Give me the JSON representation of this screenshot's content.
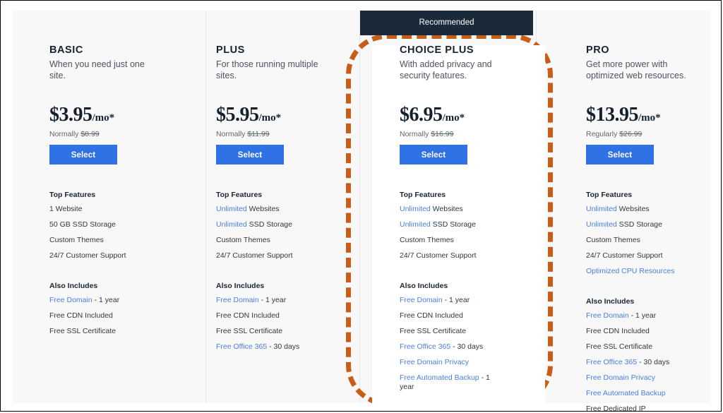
{
  "colors": {
    "accent_blue": "#2f72e5",
    "link_blue": "#4a7fe0",
    "badge_navy": "#1b2a3b",
    "annotation_orange": "#c75d17",
    "card_background": "#f8f8f9"
  },
  "badge": {
    "label": "Recommended"
  },
  "plans": [
    {
      "name": "BASIC",
      "tagline": "When you need just one site.",
      "price": "$3.95",
      "price_period": "/mo*",
      "normally_label": "Normally",
      "normally_price": "$8.99",
      "select_label": "Select",
      "top_features_heading": "Top Features",
      "top_features": [
        {
          "link": "",
          "text": "1 Website"
        },
        {
          "link": "",
          "text": "50 GB SSD Storage"
        },
        {
          "link": "",
          "text": "Custom Themes"
        },
        {
          "link": "",
          "text": "24/7 Customer Support"
        }
      ],
      "also_includes_heading": "Also Includes",
      "also_includes": [
        {
          "link": "Free Domain",
          "text": " - 1 year"
        },
        {
          "link": "",
          "text": "Free CDN Included"
        },
        {
          "link": "",
          "text": "Free SSL Certificate"
        }
      ]
    },
    {
      "name": "PLUS",
      "tagline": "For those running multiple sites.",
      "price": "$5.95",
      "price_period": "/mo*",
      "normally_label": "Normally",
      "normally_price": "$11.99",
      "select_label": "Select",
      "top_features_heading": "Top Features",
      "top_features": [
        {
          "link": "Unlimited",
          "text": " Websites"
        },
        {
          "link": "Unlimited",
          "text": " SSD Storage"
        },
        {
          "link": "",
          "text": "Custom Themes"
        },
        {
          "link": "",
          "text": "24/7 Customer Support"
        }
      ],
      "also_includes_heading": "Also Includes",
      "also_includes": [
        {
          "link": "Free Domain",
          "text": " - 1 year"
        },
        {
          "link": "",
          "text": "Free CDN Included"
        },
        {
          "link": "",
          "text": "Free SSL Certificate"
        },
        {
          "link": "Free Office 365",
          "text": " - 30 days"
        }
      ]
    },
    {
      "name": "CHOICE PLUS",
      "tagline": "With added privacy and security features.",
      "price": "$6.95",
      "price_period": "/mo*",
      "normally_label": "Normally",
      "normally_price": "$16.99",
      "select_label": "Select",
      "top_features_heading": "Top Features",
      "top_features": [
        {
          "link": "Unlimited",
          "text": " Websites"
        },
        {
          "link": "Unlimited",
          "text": " SSD Storage"
        },
        {
          "link": "",
          "text": "Custom Themes"
        },
        {
          "link": "",
          "text": "24/7 Customer Support"
        }
      ],
      "also_includes_heading": "Also Includes",
      "also_includes": [
        {
          "link": "Free Domain",
          "text": " - 1 year"
        },
        {
          "link": "",
          "text": "Free CDN Included"
        },
        {
          "link": "",
          "text": "Free SSL Certificate"
        },
        {
          "link": "Free Office 365",
          "text": " - 30 days"
        },
        {
          "link": "Free Domain Privacy",
          "text": ""
        },
        {
          "link": "Free Automated Backup",
          "text": " - 1 year"
        }
      ]
    },
    {
      "name": "PRO",
      "tagline": "Get more power with optimized web resources.",
      "price": "$13.95",
      "price_period": "/mo*",
      "normally_label": "Regularly",
      "normally_price": "$26.99",
      "select_label": "Select",
      "top_features_heading": "Top Features",
      "top_features": [
        {
          "link": "Unlimited",
          "text": " Websites"
        },
        {
          "link": "Unlimited",
          "text": " SSD Storage"
        },
        {
          "link": "",
          "text": "Custom Themes"
        },
        {
          "link": "",
          "text": "24/7 Customer Support"
        },
        {
          "link": "Optimized CPU Resources",
          "text": ""
        }
      ],
      "also_includes_heading": "Also Includes",
      "also_includes": [
        {
          "link": "Free Domain",
          "text": " - 1 year"
        },
        {
          "link": "",
          "text": "Free CDN Included"
        },
        {
          "link": "",
          "text": "Free SSL Certificate"
        },
        {
          "link": "Free Office 365",
          "text": " - 30 days"
        },
        {
          "link": "Free Domain Privacy",
          "text": ""
        },
        {
          "link": "Free Automated Backup",
          "text": ""
        },
        {
          "link": "",
          "text": "Free Dedicated IP"
        }
      ]
    }
  ]
}
